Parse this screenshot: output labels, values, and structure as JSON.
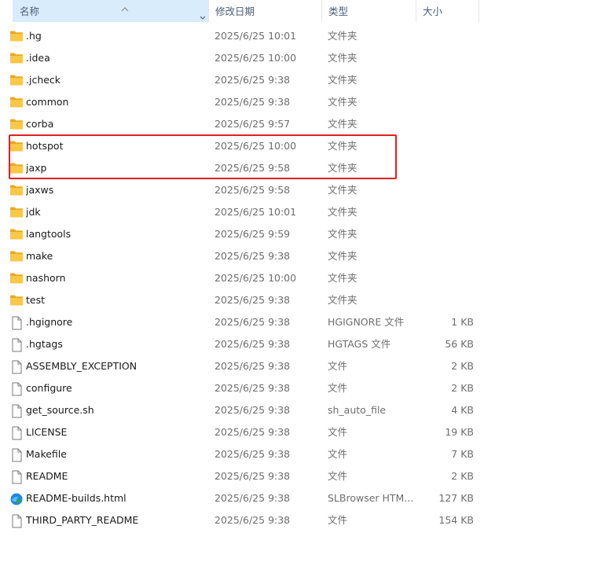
{
  "columns": {
    "name": "名称",
    "date_modified": "修改日期",
    "type": "类型",
    "size": "大小"
  },
  "icons": {
    "folder": "folder-icon",
    "file": "file-icon",
    "browser_html": "browser-html-icon",
    "sort": "sort-ascending-icon",
    "chevron": "chevron-down-icon"
  },
  "colors": {
    "highlight_box": "#e02020",
    "folder_body": "#f8c846",
    "sorted_header": "#d9ecfb"
  },
  "files": [
    {
      "name": ".hg",
      "date": "2025/6/25 10:01",
      "type": "文件夹",
      "size": "",
      "kind": "folder"
    },
    {
      "name": ".idea",
      "date": "2025/6/25 10:00",
      "type": "文件夹",
      "size": "",
      "kind": "folder"
    },
    {
      "name": ".jcheck",
      "date": "2025/6/25 9:38",
      "type": "文件夹",
      "size": "",
      "kind": "folder"
    },
    {
      "name": "common",
      "date": "2025/6/25 9:38",
      "type": "文件夹",
      "size": "",
      "kind": "folder"
    },
    {
      "name": "corba",
      "date": "2025/6/25 9:57",
      "type": "文件夹",
      "size": "",
      "kind": "folder"
    },
    {
      "name": "hotspot",
      "date": "2025/6/25 10:00",
      "type": "文件夹",
      "size": "",
      "kind": "folder"
    },
    {
      "name": "jaxp",
      "date": "2025/6/25 9:58",
      "type": "文件夹",
      "size": "",
      "kind": "folder"
    },
    {
      "name": "jaxws",
      "date": "2025/6/25 9:58",
      "type": "文件夹",
      "size": "",
      "kind": "folder"
    },
    {
      "name": "jdk",
      "date": "2025/6/25 10:01",
      "type": "文件夹",
      "size": "",
      "kind": "folder"
    },
    {
      "name": "langtools",
      "date": "2025/6/25 9:59",
      "type": "文件夹",
      "size": "",
      "kind": "folder"
    },
    {
      "name": "make",
      "date": "2025/6/25 9:38",
      "type": "文件夹",
      "size": "",
      "kind": "folder"
    },
    {
      "name": "nashorn",
      "date": "2025/6/25 10:00",
      "type": "文件夹",
      "size": "",
      "kind": "folder"
    },
    {
      "name": "test",
      "date": "2025/6/25 9:38",
      "type": "文件夹",
      "size": "",
      "kind": "folder"
    },
    {
      "name": ".hgignore",
      "date": "2025/6/25 9:38",
      "type": "HGIGNORE 文件",
      "size": "1 KB",
      "kind": "file"
    },
    {
      "name": ".hgtags",
      "date": "2025/6/25 9:38",
      "type": "HGTAGS 文件",
      "size": "56 KB",
      "kind": "file"
    },
    {
      "name": "ASSEMBLY_EXCEPTION",
      "date": "2025/6/25 9:38",
      "type": "文件",
      "size": "2 KB",
      "kind": "file"
    },
    {
      "name": "configure",
      "date": "2025/6/25 9:38",
      "type": "文件",
      "size": "2 KB",
      "kind": "file"
    },
    {
      "name": "get_source.sh",
      "date": "2025/6/25 9:38",
      "type": "sh_auto_file",
      "size": "4 KB",
      "kind": "file"
    },
    {
      "name": "LICENSE",
      "date": "2025/6/25 9:38",
      "type": "文件",
      "size": "19 KB",
      "kind": "file"
    },
    {
      "name": "Makefile",
      "date": "2025/6/25 9:38",
      "type": "文件",
      "size": "7 KB",
      "kind": "file"
    },
    {
      "name": "README",
      "date": "2025/6/25 9:38",
      "type": "文件",
      "size": "2 KB",
      "kind": "file"
    },
    {
      "name": "README-builds.html",
      "date": "2025/6/25 9:38",
      "type": "SLBrowser HTM...",
      "size": "127 KB",
      "kind": "html"
    },
    {
      "name": "THIRD_PARTY_README",
      "date": "2025/6/25 9:38",
      "type": "文件",
      "size": "154 KB",
      "kind": "file"
    }
  ]
}
